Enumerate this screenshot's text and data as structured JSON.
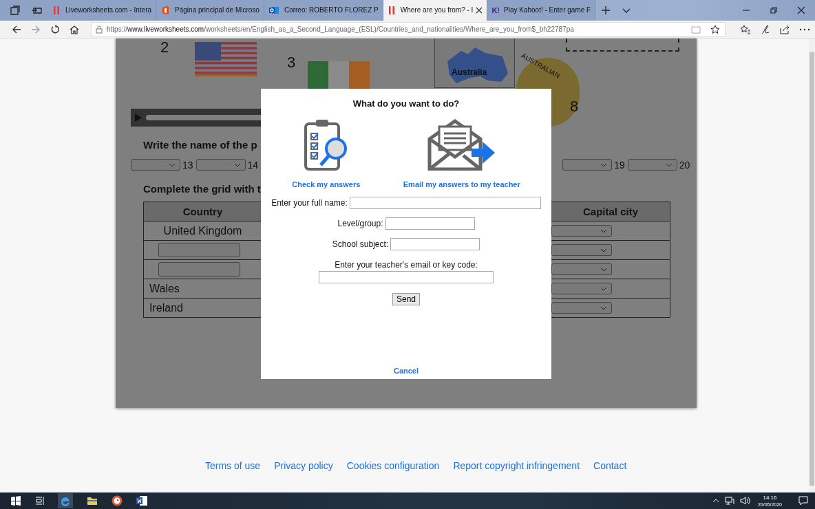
{
  "browser": {
    "tabs": [
      {
        "title": "Liveworksheets.com - Intera",
        "selected": false
      },
      {
        "title": "Página principal de Microso",
        "selected": false
      },
      {
        "title": "Correo: ROBERTO FLOREZ P",
        "selected": false
      },
      {
        "title": "Where are you from? - I",
        "selected": true
      },
      {
        "title": "Play Kahoot! - Enter game F",
        "icon_text": "K!",
        "selected": false
      }
    ],
    "url": {
      "scheme": "https://",
      "domain": "www.liveworksheets.com",
      "path": "/worksheets/en/English_as_a_Second_Language_(ESL)/Countries_and_nationalities/Where_are_you_from$_bh22787pa"
    }
  },
  "worksheet": {
    "numbers": [
      "2",
      "3",
      "8"
    ],
    "map_label": "Australia",
    "badge_text": "AUSTRALIAN",
    "instruction_1": "Write the name of the p",
    "dropdowns": [
      {
        "number": "13"
      },
      {
        "number": "14"
      },
      {
        "number": "19"
      },
      {
        "number": "20"
      }
    ],
    "instruction_2": "Complete the grid with t",
    "table": {
      "columns": [
        "Country",
        "Capital city"
      ],
      "rows": [
        {
          "kind": "text",
          "country": "United Kingdom"
        },
        {
          "kind": "input"
        },
        {
          "kind": "input"
        },
        {
          "kind": "text",
          "country": "Wales"
        },
        {
          "kind": "text",
          "country": "Ireland"
        }
      ]
    }
  },
  "dialog": {
    "title": "What do you want to do?",
    "options": [
      {
        "kind": "check",
        "label": "Check my answers"
      },
      {
        "kind": "email",
        "label": "Email my answers to my teacher"
      }
    ],
    "fields": [
      {
        "label": "Enter your full name:"
      },
      {
        "label": "Level/group:"
      },
      {
        "label": "School subject:"
      },
      {
        "label": "Enter your teacher's email or key code:"
      }
    ],
    "send": "Send",
    "cancel": "Cancel"
  },
  "footer_links": [
    "Terms of use",
    "Privacy policy",
    "Cookies configuration",
    "Report copyright infringement",
    "Contact"
  ],
  "taskbar": {
    "time": "14:16",
    "date": "20/05/2020"
  }
}
